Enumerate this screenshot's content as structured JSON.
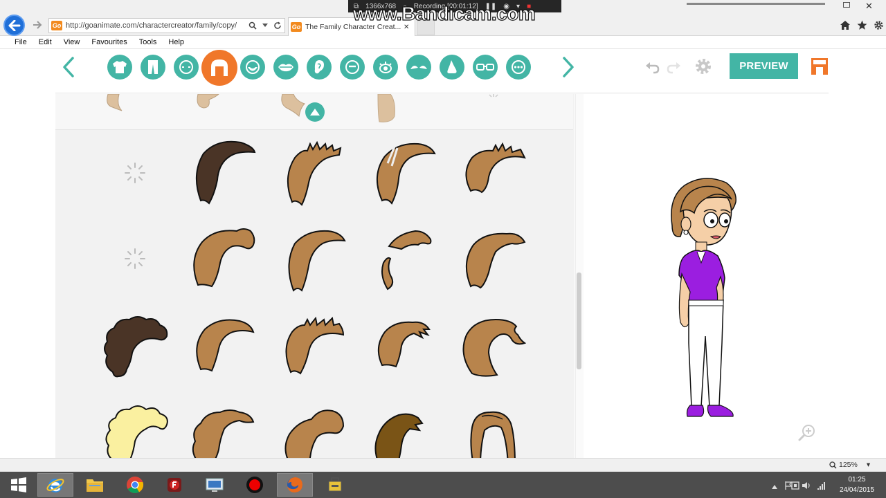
{
  "recorder": {
    "watermark": "www.Bandicam.com",
    "resolution": "1366x768",
    "status": "Recording [00:01:12]"
  },
  "browser": {
    "url": "http://goanimate.com/charactercreator/family/copy/",
    "tab_title": "The Family Character Creat...",
    "menu": [
      "File",
      "Edit",
      "View",
      "Favourites",
      "Tools",
      "Help"
    ],
    "zoom": "125%"
  },
  "app": {
    "preview_label": "PREVIEW",
    "categories": [
      "top",
      "bottom",
      "face-shape",
      "hair",
      "facial-hair",
      "mouth",
      "ear",
      "nose-line",
      "eyes",
      "eyebrows",
      "nose",
      "glasses",
      "accessories"
    ],
    "active_category": "hair",
    "colors": {
      "accent": "#43b5a5",
      "active": "#f0772a",
      "hair_brown": "#b8844c",
      "hair_dark": "#4a3426",
      "hair_blonde": "#faf0a0",
      "shirt": "#9b1ee0"
    }
  },
  "taskbar": {
    "time": "01:25",
    "date": "24/04/2015",
    "apps": [
      "start",
      "internet-explorer",
      "file-explorer",
      "chrome",
      "flash-app",
      "remote-desktop",
      "bandicam",
      "firefox",
      "scanner"
    ]
  }
}
